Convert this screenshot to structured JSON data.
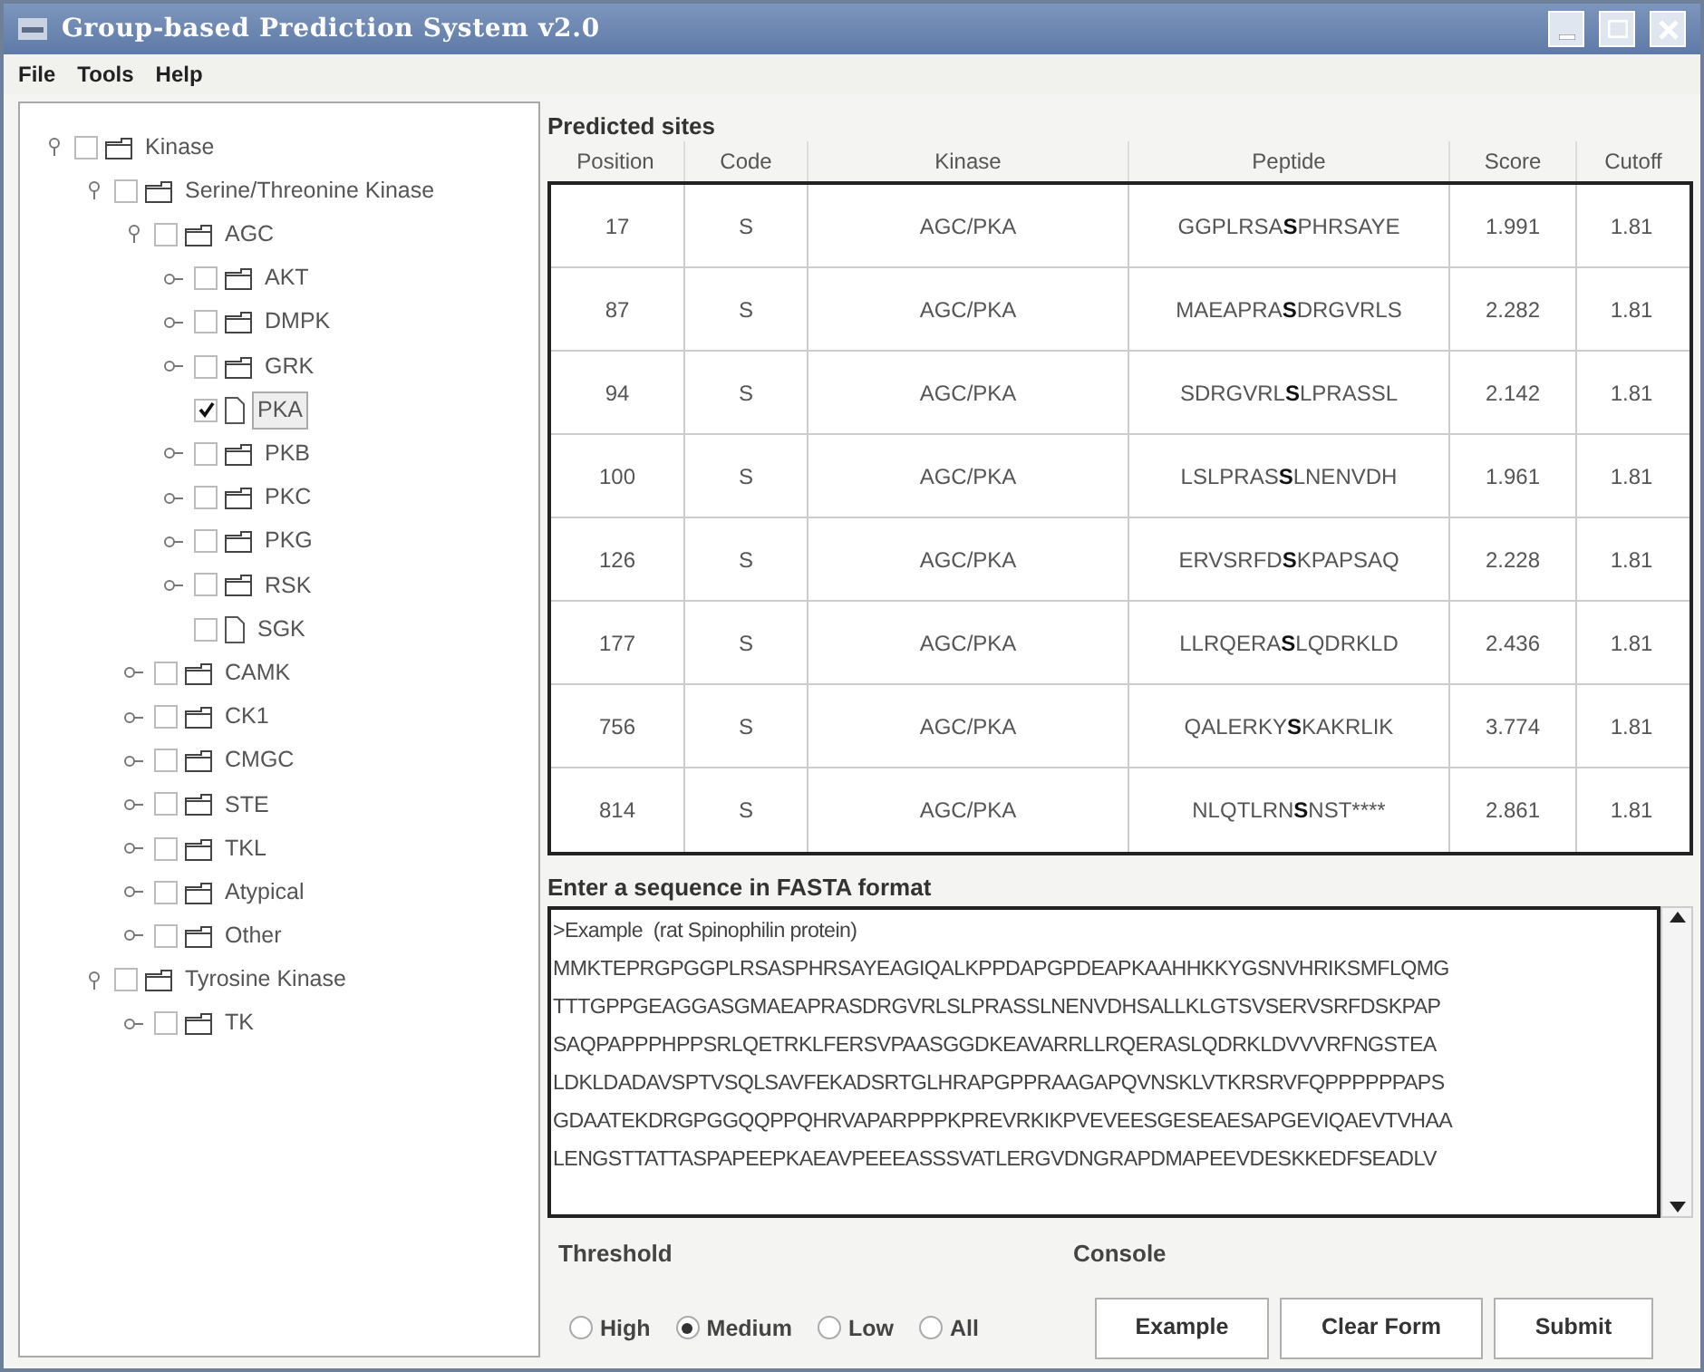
{
  "window": {
    "title": "Group-based Prediction System v2.0"
  },
  "menu": [
    "File",
    "Tools",
    "Help"
  ],
  "tree": [
    {
      "label": "Kinase",
      "kind": "folder",
      "checked": false,
      "expanded": true,
      "selected": false,
      "children": [
        {
          "label": "Serine/Threonine Kinase",
          "kind": "folder",
          "checked": false,
          "expanded": true,
          "selected": false,
          "children": [
            {
              "label": "AGC",
              "kind": "folder",
              "checked": false,
              "expanded": true,
              "selected": false,
              "children": [
                {
                  "label": "AKT",
                  "kind": "folder",
                  "checked": false,
                  "expanded": false,
                  "selected": false
                },
                {
                  "label": "DMPK",
                  "kind": "folder",
                  "checked": false,
                  "expanded": false,
                  "selected": false
                },
                {
                  "label": "GRK",
                  "kind": "folder",
                  "checked": false,
                  "expanded": false,
                  "selected": false
                },
                {
                  "label": "PKA",
                  "kind": "leaf",
                  "checked": true,
                  "selected": true
                },
                {
                  "label": "PKB",
                  "kind": "folder",
                  "checked": false,
                  "expanded": false,
                  "selected": false
                },
                {
                  "label": "PKC",
                  "kind": "folder",
                  "checked": false,
                  "expanded": false,
                  "selected": false
                },
                {
                  "label": "PKG",
                  "kind": "folder",
                  "checked": false,
                  "expanded": false,
                  "selected": false
                },
                {
                  "label": "RSK",
                  "kind": "folder",
                  "checked": false,
                  "expanded": false,
                  "selected": false
                },
                {
                  "label": "SGK",
                  "kind": "leaf",
                  "checked": false,
                  "selected": false
                }
              ]
            },
            {
              "label": "CAMK",
              "kind": "folder",
              "checked": false,
              "expanded": false,
              "selected": false
            },
            {
              "label": "CK1",
              "kind": "folder",
              "checked": false,
              "expanded": false,
              "selected": false
            },
            {
              "label": "CMGC",
              "kind": "folder",
              "checked": false,
              "expanded": false,
              "selected": false
            },
            {
              "label": "STE",
              "kind": "folder",
              "checked": false,
              "expanded": false,
              "selected": false
            },
            {
              "label": "TKL",
              "kind": "folder",
              "checked": false,
              "expanded": false,
              "selected": false
            },
            {
              "label": "Atypical",
              "kind": "folder",
              "checked": false,
              "expanded": false,
              "selected": false
            },
            {
              "label": "Other",
              "kind": "folder",
              "checked": false,
              "expanded": false,
              "selected": false
            }
          ]
        },
        {
          "label": "Tyrosine Kinase",
          "kind": "folder",
          "checked": false,
          "expanded": true,
          "selected": false,
          "children": [
            {
              "label": "TK",
              "kind": "folder",
              "checked": false,
              "expanded": false,
              "selected": false
            }
          ]
        }
      ]
    }
  ],
  "results": {
    "title": "Predicted sites",
    "columns": [
      "Position",
      "Code",
      "Kinase",
      "Peptide",
      "Score",
      "Cutoff"
    ],
    "rows": [
      [
        "17",
        "S",
        "AGC/PKA",
        "GGPLRSA**S**PHRSAYE",
        "1.991",
        "1.81"
      ],
      [
        "87",
        "S",
        "AGC/PKA",
        "MAEAPRA**S**DRGVRLS",
        "2.282",
        "1.81"
      ],
      [
        "94",
        "S",
        "AGC/PKA",
        "SDRGVRL**S**LPRASSL",
        "2.142",
        "1.81"
      ],
      [
        "100",
        "S",
        "AGC/PKA",
        "LSLPRAS**S**LNENVDH",
        "1.961",
        "1.81"
      ],
      [
        "126",
        "S",
        "AGC/PKA",
        "ERVSRFD**S**KPAPSAQ",
        "2.228",
        "1.81"
      ],
      [
        "177",
        "S",
        "AGC/PKA",
        "LLRQERA**S**LQDRKLD",
        "2.436",
        "1.81"
      ],
      [
        "756",
        "S",
        "AGC/PKA",
        "QALERKY**S**KAKRLIK",
        "3.774",
        "1.81"
      ],
      [
        "814",
        "S",
        "AGC/PKA",
        "NLQTLRN**S**NST****",
        "2.861",
        "1.81"
      ]
    ]
  },
  "sequence": {
    "label": "Enter a sequence in FASTA format",
    "lines": [
      ">Example  (rat Spinophilin protein)",
      "MMKTEPRGPGGPLRSASPHRSAYEAGIQALKPPDAPGPDEAPKAAHHKKYGSNVHRIKSMFLQMG",
      "TTTGPPGEAGGASGMAEAPRASDRGVRLSLPRASSLNENVDHSALLKLGTSVSERVSRFDSKPAP",
      "SAQPAPPPHPPSRLQETRKLFERSVPAASGGDKEAVARRLLRQERASLQDRKLDVVVRFNGSTEA",
      "LDKLDADAVSPTVSQLSAVFEKADSRTGLHRAPGPPRAAGAPQVNSKLVTKRSRVFQPPPPPPAPS",
      "GDAATEKDRGPGGQQPPQHRVAPARPPPKPREVRKIKPVEVEESGESEAESAPGEVIQAEVTVHAA",
      "LENGSTTATTASPAPEEPKAEAVPEEEASSSVATLERGVDNGRAPDMAPEEVDESKKEDFSEADLV"
    ]
  },
  "threshold": {
    "label": "Threshold",
    "options": [
      {
        "label": "High",
        "selected": false
      },
      {
        "label": "Medium",
        "selected": true
      },
      {
        "label": "Low",
        "selected": false
      },
      {
        "label": "All",
        "selected": false
      }
    ]
  },
  "console": {
    "label": "Console",
    "buttons": [
      "Example",
      "Clear Form",
      "Submit"
    ]
  }
}
